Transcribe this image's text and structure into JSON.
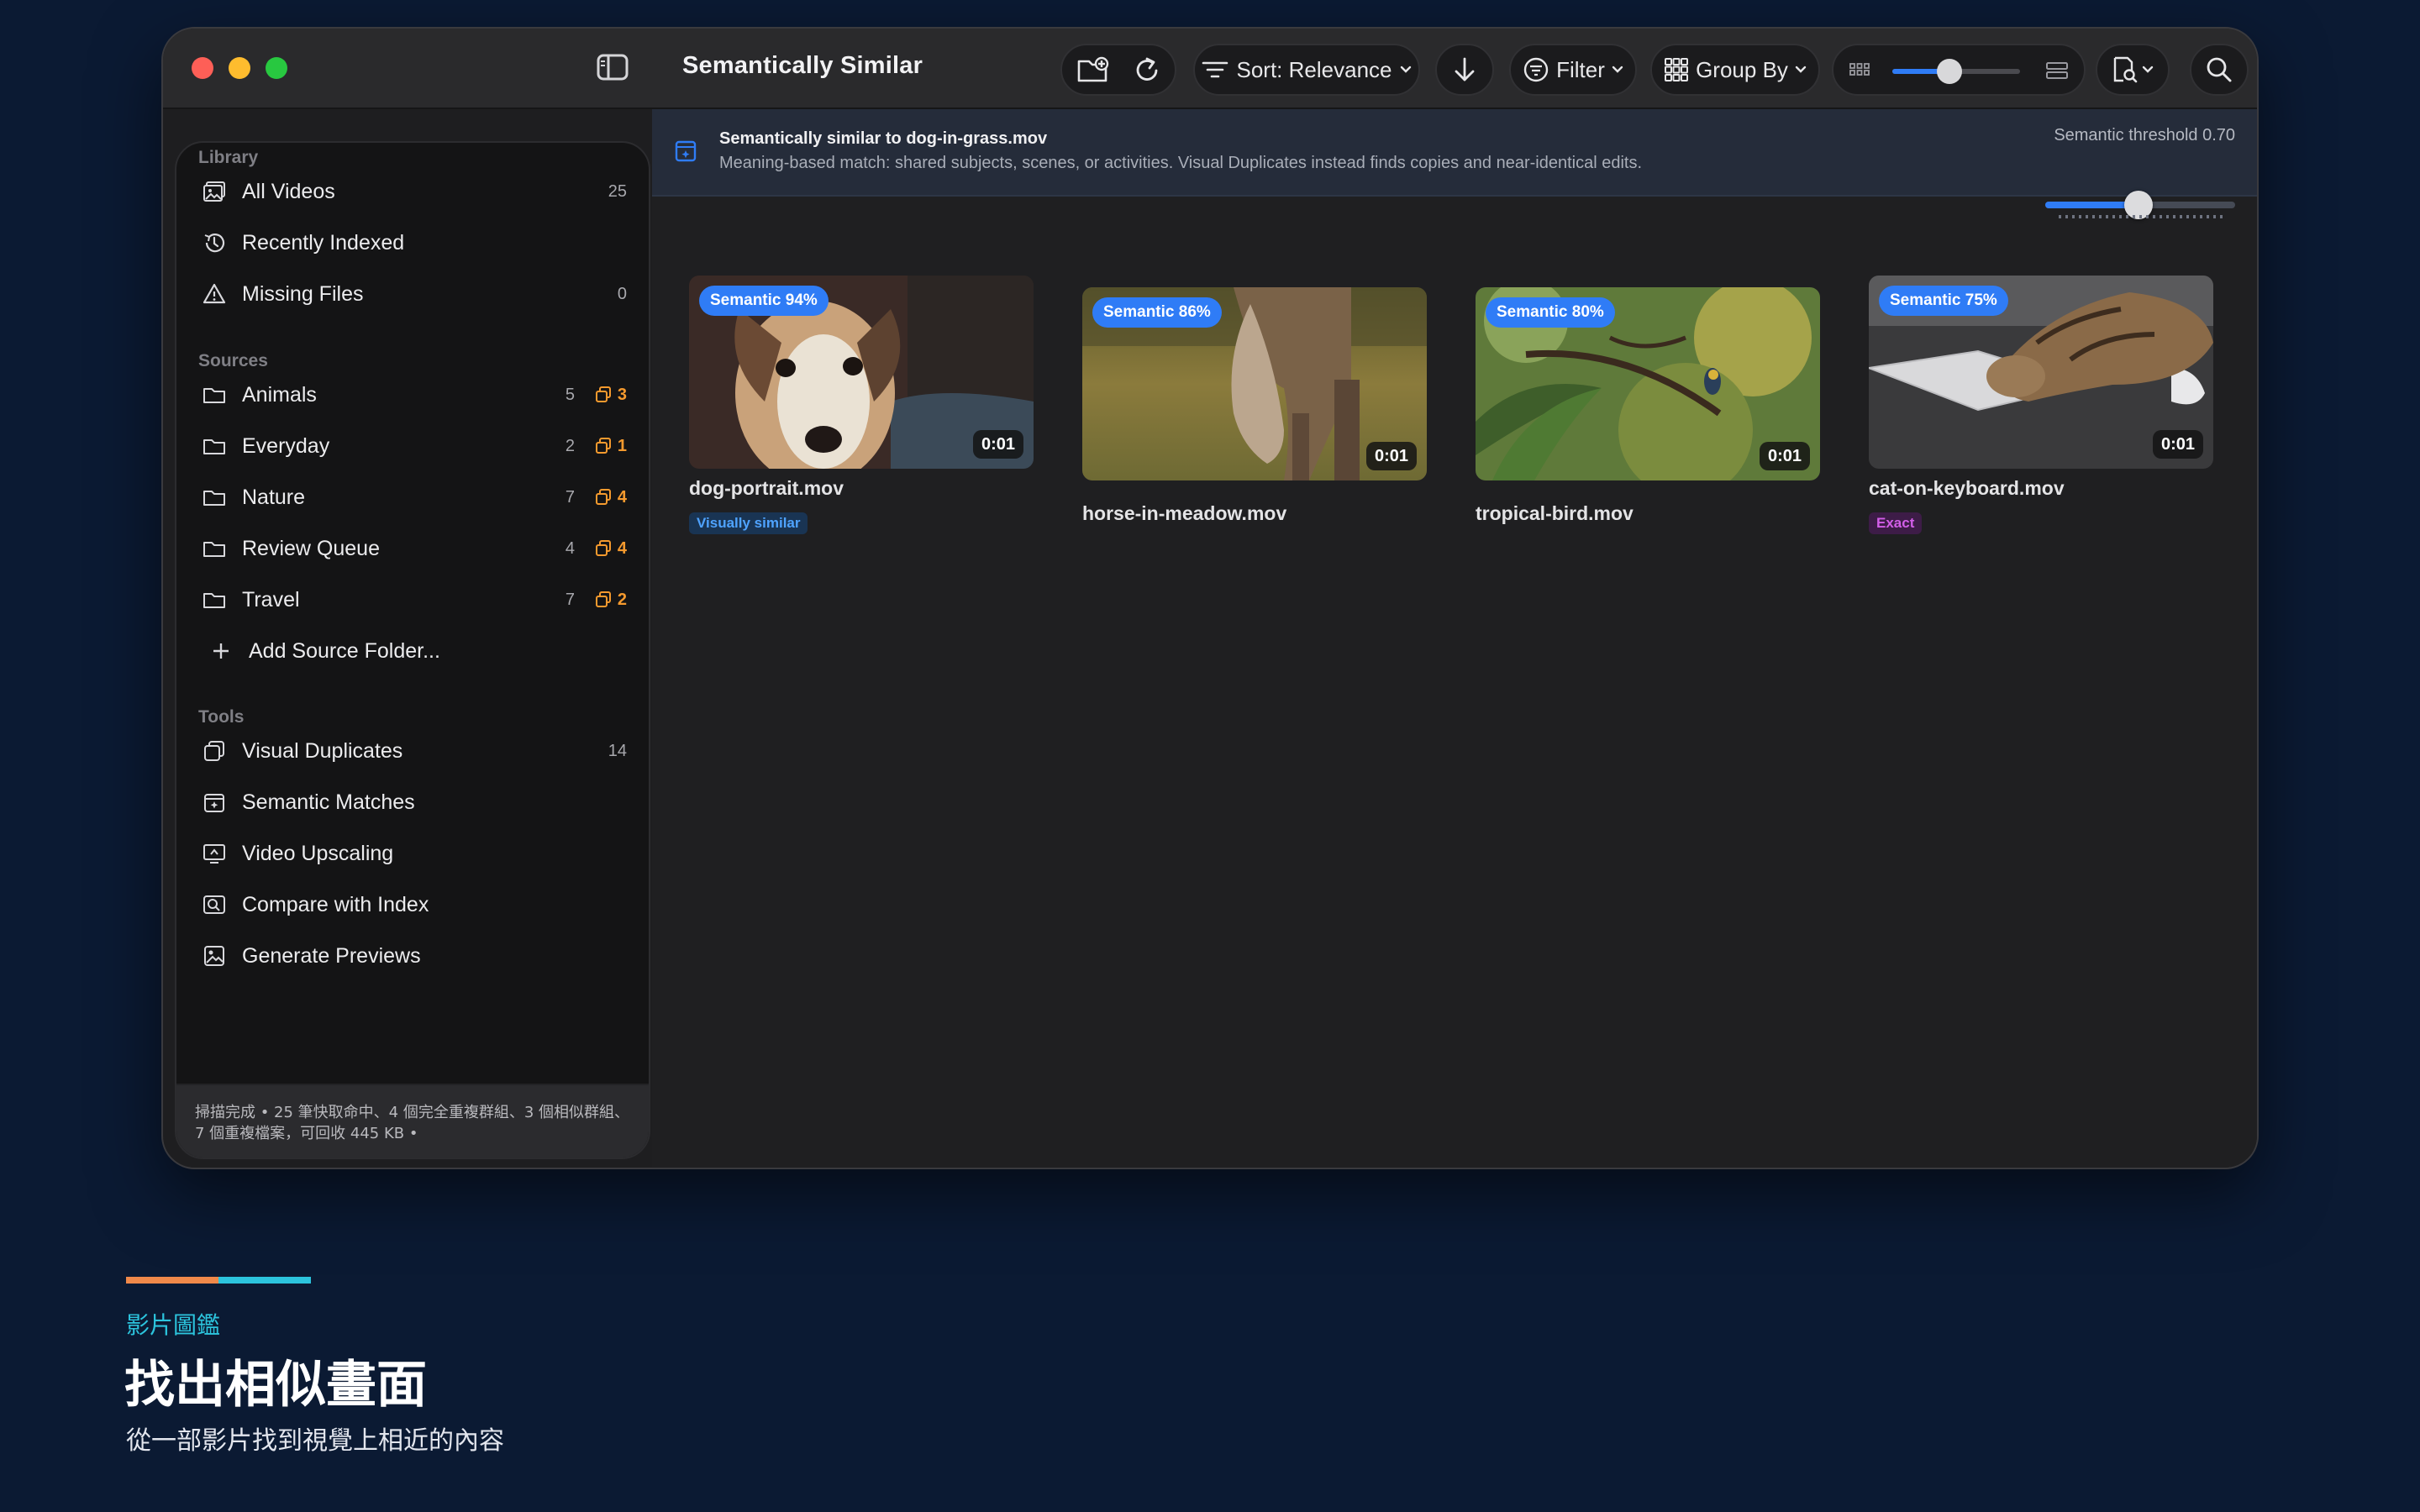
{
  "window": {
    "title": "Semantically Similar"
  },
  "toolbar": {
    "sort_label": "Sort: Relevance",
    "filter_label": "Filter",
    "group_label": "Group By",
    "zoom_level": 0.45
  },
  "sidebar": {
    "library_title": "Library",
    "library": [
      {
        "label": "All Videos",
        "count": "25",
        "icon": "photo-library-icon"
      },
      {
        "label": "Recently Indexed",
        "count": "",
        "icon": "clock-history-icon"
      },
      {
        "label": "Missing Files",
        "count": "0",
        "icon": "warning-triangle-icon"
      }
    ],
    "sources_title": "Sources",
    "sources": [
      {
        "label": "Animals",
        "count": "5",
        "dups": "3"
      },
      {
        "label": "Everyday",
        "count": "2",
        "dups": "1"
      },
      {
        "label": "Nature",
        "count": "7",
        "dups": "4"
      },
      {
        "label": "Review Queue",
        "count": "4",
        "dups": "4"
      },
      {
        "label": "Travel",
        "count": "7",
        "dups": "2"
      }
    ],
    "add_source_label": "Add Source Folder...",
    "tools_title": "Tools",
    "tools": [
      {
        "label": "Visual Duplicates",
        "count": "14",
        "icon": "duplicate-icon"
      },
      {
        "label": "Semantic Matches",
        "count": "",
        "icon": "semantic-match-icon"
      },
      {
        "label": "Video Upscaling",
        "count": "",
        "icon": "upscale-icon"
      },
      {
        "label": "Compare with Index",
        "count": "",
        "icon": "compare-icon"
      },
      {
        "label": "Generate Previews",
        "count": "",
        "icon": "preview-icon"
      }
    ],
    "status_text": "掃描完成 • 25 筆快取命中、4 個完全重複群組、3 個相似群組、7 個重複檔案，可回收 445 KB •"
  },
  "banner": {
    "title": "Semantically similar to dog-in-grass.mov",
    "description": "Meaning-based match: shared subjects, scenes, or activities. Visual Duplicates instead finds copies and near-identical edits.",
    "threshold_label": "Semantic threshold 0.70",
    "threshold_value": 0.7
  },
  "results": [
    {
      "badge": "Semantic 94%",
      "duration": "0:01",
      "filename": "dog-portrait.mov",
      "tag": "Visually similar",
      "tag_kind": "visual",
      "subject": "dog-thumbnail"
    },
    {
      "badge": "Semantic 86%",
      "duration": "0:01",
      "filename": "horse-in-meadow.mov",
      "tag": "",
      "tag_kind": "",
      "subject": "horse-thumbnail"
    },
    {
      "badge": "Semantic 80%",
      "duration": "0:01",
      "filename": "tropical-bird.mov",
      "tag": "",
      "tag_kind": "",
      "subject": "bird-thumbnail"
    },
    {
      "badge": "Semantic 75%",
      "duration": "0:01",
      "filename": "cat-on-keyboard.mov",
      "tag": "Exact",
      "tag_kind": "exact",
      "subject": "cat-thumbnail"
    }
  ],
  "marketing": {
    "kicker": "影片圖鑑",
    "title": "找出相似畫面",
    "subtitle": "從一部影片找到視覺上相近的內容"
  },
  "colors": {
    "accent_blue": "#2f7cf6",
    "duplicate_orange": "#f59a2e",
    "page_background": "#0b1a33"
  }
}
